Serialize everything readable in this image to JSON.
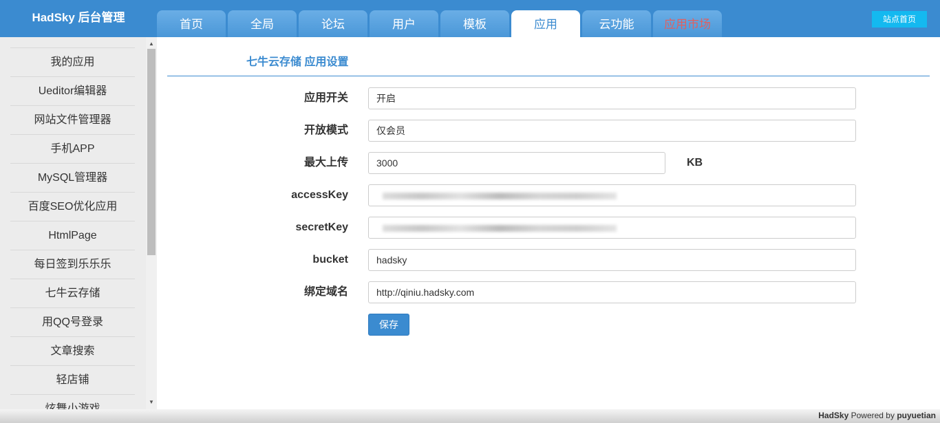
{
  "header": {
    "brand": "HadSky 后台管理",
    "tabs": [
      "首页",
      "全局",
      "论坛",
      "用户",
      "模板",
      "应用",
      "云功能",
      "应用市场"
    ],
    "home_button": "站点首页"
  },
  "sidebar": {
    "items": [
      "我的应用",
      "Ueditor编辑器",
      "网站文件管理器",
      "手机APP",
      "MySQL管理器",
      "百度SEO优化应用",
      "HtmlPage",
      "每日签到乐乐乐",
      "七牛云存储",
      "用QQ号登录",
      "文章搜索",
      "轻店铺",
      "炫舞小游戏"
    ]
  },
  "form": {
    "title": "七牛云存储 应用设置",
    "rows": {
      "switch": {
        "label": "应用开关",
        "value": "开启"
      },
      "mode": {
        "label": "开放模式",
        "value": "仅会员"
      },
      "max_upload": {
        "label": "最大上传",
        "value": "3000",
        "unit": "KB"
      },
      "access_key": {
        "label": "accessKey",
        "value": ""
      },
      "secret_key": {
        "label": "secretKey",
        "value": ""
      },
      "bucket": {
        "label": "bucket",
        "value": "hadsky"
      },
      "domain": {
        "label": "绑定域名",
        "value": "http://qiniu.hadsky.com"
      }
    },
    "save_label": "保存"
  },
  "footer": {
    "brand": "HadSky",
    "powered": "Powered by",
    "author": "puyuetian"
  },
  "colors": {
    "header": "#3b8bd0",
    "active_tab_text": "#3b8bd0",
    "market_tab_text": "#e06060",
    "home_button": "#14b9f0"
  }
}
